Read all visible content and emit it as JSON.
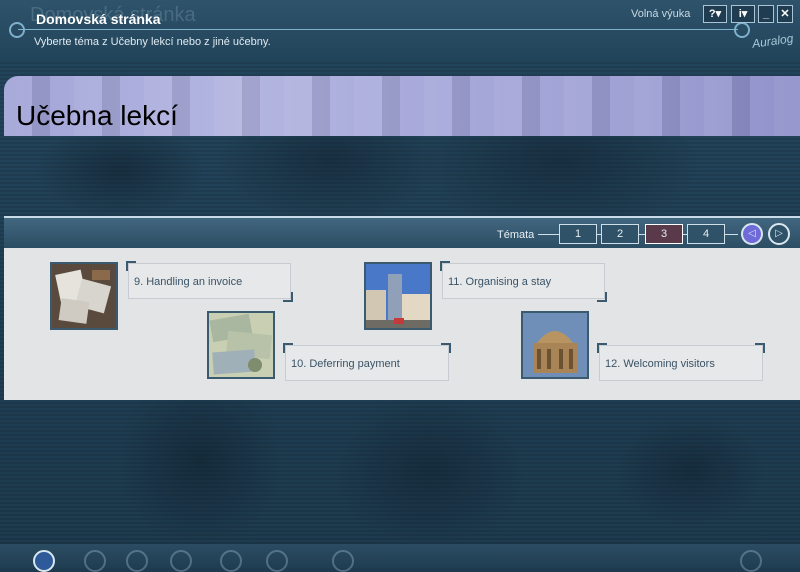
{
  "window": {
    "ghost_title": "Domovská stránka",
    "title": "Domovská stránka",
    "subtitle": "Vyberte téma z Učebny lekcí nebo z jiné učebny.",
    "mode": "Volná výuka",
    "help_button": "?▾",
    "info_button": "i▾",
    "minimize_button": "_",
    "close_button": "✕",
    "logo": "Auralog"
  },
  "banner": {
    "title": "Učebna lekcí"
  },
  "topics": {
    "label": "Témata",
    "pages": [
      "1",
      "2",
      "3",
      "4"
    ],
    "active_page": "3",
    "prev_symbol": "◁",
    "next_symbol": "▷"
  },
  "lessons": [
    {
      "label": "9. Handling an invoice",
      "image_icon": "invoice-papers-image"
    },
    {
      "label": "10. Deferring payment",
      "image_icon": "banknotes-image"
    },
    {
      "label": "11. Organising a stay",
      "image_icon": "city-buildings-image"
    },
    {
      "label": "12. Welcoming visitors",
      "image_icon": "domed-building-image"
    }
  ],
  "colors": {
    "header": "#2e536b",
    "banner": "#a2a4d8",
    "content_bg": "#e2e4e6",
    "active_page": "#5a3a4a",
    "lesson_text": "#3a5366"
  }
}
